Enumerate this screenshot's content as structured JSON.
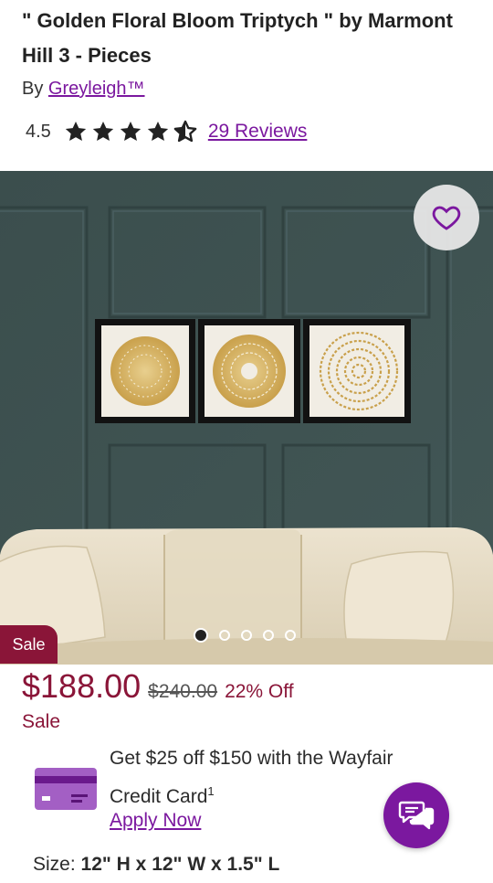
{
  "product": {
    "title": "\" Golden Floral Bloom Triptych \" by Marmont Hill 3 - Pieces",
    "by_label": "By",
    "brand": "Greyleigh™",
    "rating": "4.5",
    "rating_value": 4.5,
    "reviews_link": "29 Reviews"
  },
  "gallery": {
    "favorite_icon": "heart-icon",
    "dot_count": 5,
    "active_dot": 1,
    "sale_tag": "Sale"
  },
  "pricing": {
    "price": "$188.00",
    "original_price": "$240.00",
    "discount": "22% Off",
    "sale_label": "Sale"
  },
  "promo": {
    "line1": "Get $25 off $150 with the Wayfair",
    "line2": "Credit Card",
    "footnote": "1",
    "apply_link": "Apply Now",
    "card_icon": "credit-card-icon"
  },
  "chat": {
    "icon": "chat-icon"
  },
  "size": {
    "label": "Size:",
    "value": "12\" H x 12\" W x 1.5\" L"
  },
  "colors": {
    "brand_purple": "#7b189f",
    "sale_red": "#8a1538",
    "wall": "#3f5453"
  }
}
